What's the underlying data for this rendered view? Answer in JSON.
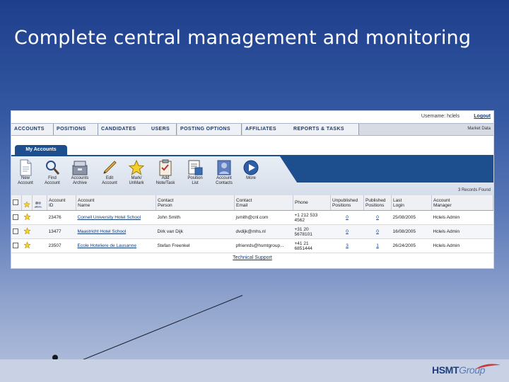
{
  "slide": {
    "title": "Complete central management and monitoring"
  },
  "topbar": {
    "username_label": "Username:",
    "username_value": "hclels",
    "logout": "Logout",
    "market": "Market Data"
  },
  "nav": {
    "tabs": [
      "ACCOUNTS",
      "POSITIONS",
      "CANDIDATES",
      "USERS",
      "POSTING OPTIONS",
      "AFFILIATES",
      "REPORTS & TASKS"
    ]
  },
  "section_tab": "My Accounts",
  "toolbar": {
    "buttons": [
      {
        "icon": "document-icon",
        "label": "New\nAccount"
      },
      {
        "icon": "magnifier-icon",
        "label": "Find\nAccount"
      },
      {
        "icon": "archive-icon",
        "label": "Accounts\nArchive"
      },
      {
        "icon": "pencil-icon",
        "label": "Edit\nAccount"
      },
      {
        "icon": "star-icon",
        "label": "Mark/\nUnMark"
      },
      {
        "icon": "clipboard-icon",
        "label": "Add\nNote/Task"
      },
      {
        "icon": "position-list-icon",
        "label": "Position\nList"
      },
      {
        "icon": "contacts-icon",
        "label": "Account\nContacts"
      },
      {
        "icon": "play-icon",
        "label": "More"
      }
    ],
    "records_found": "3 Records Found"
  },
  "table": {
    "headers": [
      "Account\nID",
      "Account\nName",
      "Contact\nPerson",
      "Contact\nEmail",
      "Phone",
      "Unpublished\nPositions",
      "Published\nPositions",
      "Last\nLogin",
      "Account\nManager"
    ],
    "rows": [
      {
        "id": "23476",
        "name": "Cornell University Hotel School",
        "contact": "John Smith",
        "email": "jsmith@cnl.com",
        "phone": "+1 212 533\n4562",
        "unpublished": "0",
        "published": "0",
        "last_login": "25/08/2005",
        "manager": "Hclels Admin"
      },
      {
        "id": "13477",
        "name": "Maastricht Hotel School",
        "contact": "Dirk van Dijk",
        "email": "dvdijk@mhs.nl",
        "phone": "+31 20\n5678101",
        "unpublished": "0",
        "published": "0",
        "last_login": "16/08/2005",
        "manager": "Hclels Admin"
      },
      {
        "id": "23507",
        "name": "Ecole Hoteliere de Lausanne",
        "contact": "Stefan Freenkel",
        "email": "pfrienrds@hsmtgroup...",
        "phone": "+41 21\n6851444",
        "unpublished": "3",
        "published": "1",
        "last_login": "26/24/2005",
        "manager": "Hclels Admin"
      }
    ]
  },
  "footer": {
    "support": "Technical Support"
  },
  "logo": {
    "part1": "HSMT",
    "part2": "Group"
  },
  "colors": {
    "accent": "#1d4f8e",
    "background_top": "#1e3f8c",
    "link": "#123c7c"
  }
}
